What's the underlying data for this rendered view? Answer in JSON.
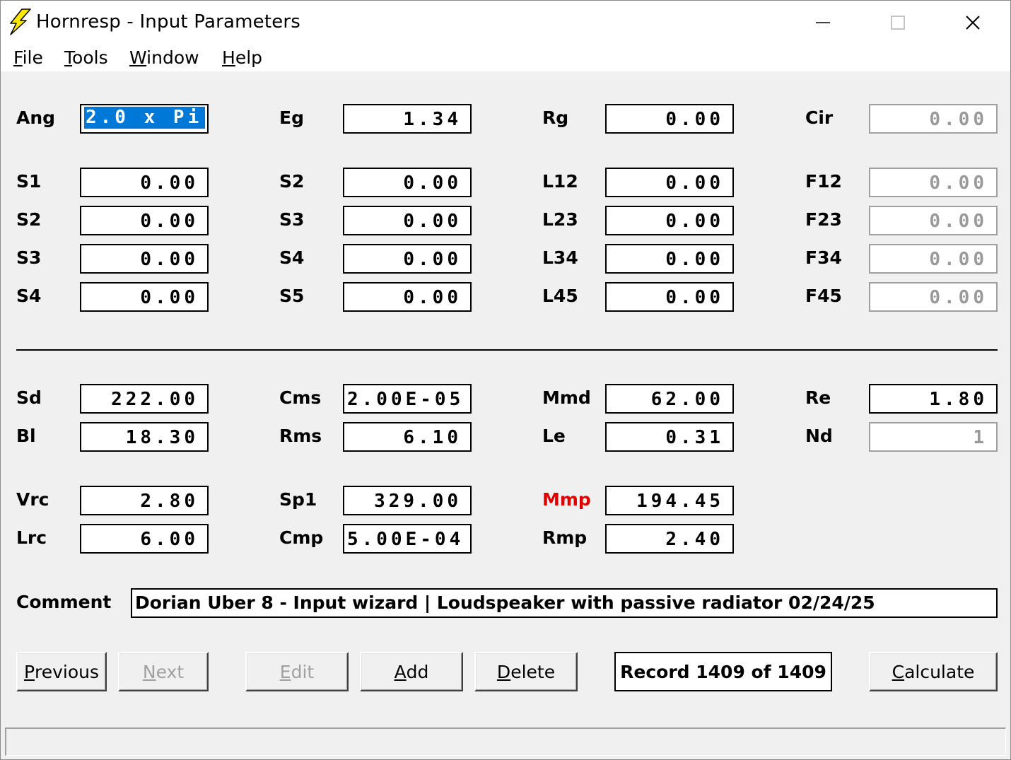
{
  "window": {
    "title": "Hornresp - Input Parameters",
    "app_icon": "lightning-bolt-icon",
    "controls": {
      "minimize": "minimize-icon",
      "maximize": "maximize-icon",
      "close": "close-icon"
    }
  },
  "menu": [
    {
      "acc": "F",
      "rest": "ile"
    },
    {
      "acc": "T",
      "rest": "ools"
    },
    {
      "acc": "W",
      "rest": "indow"
    },
    {
      "acc": "H",
      "rest": "elp"
    }
  ],
  "params": {
    "Ang": {
      "label": "Ang",
      "value": "2.0 x Pi"
    },
    "Eg": {
      "label": "Eg",
      "value": "1.34"
    },
    "Rg": {
      "label": "Rg",
      "value": "0.00"
    },
    "Cir": {
      "label": "Cir",
      "value": "0.00"
    },
    "r1": [
      {
        "label": "S1",
        "value": "0.00"
      },
      {
        "label": "S2",
        "value": "0.00"
      },
      {
        "label": "L12",
        "value": "0.00"
      },
      {
        "label": "F12",
        "value": "0.00"
      }
    ],
    "r2": [
      {
        "label": "S2",
        "value": "0.00"
      },
      {
        "label": "S3",
        "value": "0.00"
      },
      {
        "label": "L23",
        "value": "0.00"
      },
      {
        "label": "F23",
        "value": "0.00"
      }
    ],
    "r3": [
      {
        "label": "S3",
        "value": "0.00"
      },
      {
        "label": "S4",
        "value": "0.00"
      },
      {
        "label": "L34",
        "value": "0.00"
      },
      {
        "label": "F34",
        "value": "0.00"
      }
    ],
    "r4": [
      {
        "label": "S4",
        "value": "0.00"
      },
      {
        "label": "S5",
        "value": "0.00"
      },
      {
        "label": "L45",
        "value": "0.00"
      },
      {
        "label": "F45",
        "value": "0.00"
      }
    ]
  },
  "driver": {
    "Sd": {
      "label": "Sd",
      "value": "222.00"
    },
    "Cms": {
      "label": "Cms",
      "value": "2.00E-05"
    },
    "Mmd": {
      "label": "Mmd",
      "value": "62.00"
    },
    "Re": {
      "label": "Re",
      "value": "1.80"
    },
    "Bl": {
      "label": "Bl",
      "value": "18.30"
    },
    "Rms": {
      "label": "Rms",
      "value": "6.10"
    },
    "Le": {
      "label": "Le",
      "value": "0.31"
    },
    "Nd": {
      "label": "Nd",
      "value": "1"
    },
    "Vrc": {
      "label": "Vrc",
      "value": "2.80"
    },
    "Sp1": {
      "label": "Sp1",
      "value": "329.00"
    },
    "Mmp": {
      "label": "Mmp",
      "value": "194.45",
      "color": "#e00000"
    },
    "Lrc": {
      "label": "Lrc",
      "value": "6.00"
    },
    "Cmp": {
      "label": "Cmp",
      "value": "5.00E-04"
    },
    "Rmp": {
      "label": "Rmp",
      "value": "2.40"
    }
  },
  "comment": {
    "label": "Comment",
    "value": "Dorian Uber 8 - Input wizard | Loudspeaker with passive radiator 02/24/25"
  },
  "buttons": {
    "previous": {
      "acc": "P",
      "rest": "revious"
    },
    "next": {
      "acc": "N",
      "rest": "ext"
    },
    "edit": {
      "acc": "E",
      "rest": "dit"
    },
    "add": {
      "acc": "A",
      "rest": "dd"
    },
    "delete": {
      "acc": "D",
      "rest": "elete"
    },
    "calculate": {
      "acc": "C",
      "rest": "alculate"
    }
  },
  "record": "Record 1409 of 1409",
  "colors": {
    "selection": "#0078d7",
    "highlight_label": "#e00000",
    "disabled_text": "#9a9a9a"
  }
}
